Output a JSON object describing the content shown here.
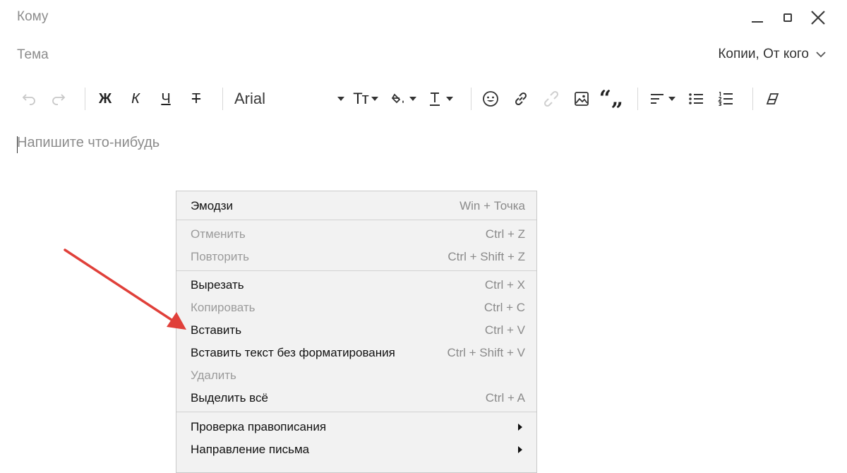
{
  "header": {
    "to_label": "Кому",
    "subject_label": "Тема",
    "copies_toggle": "Копии, От кого"
  },
  "toolbar": {
    "bold": "Ж",
    "italic": "К",
    "underline": "Ч",
    "strike": "Т",
    "font_family": "Arial",
    "font_size_label": "Тт",
    "icons": [
      "undo-icon",
      "redo-icon",
      "font-size-icon",
      "fill-color-icon",
      "text-color-icon",
      "emoji-icon",
      "link-icon",
      "unlink-icon",
      "image-icon",
      "quote-icon",
      "align-icon",
      "bullet-list-icon",
      "numbered-list-icon",
      "clear-format-icon"
    ]
  },
  "editor": {
    "placeholder": "Напишите что-нибудь"
  },
  "context_menu": {
    "items": [
      {
        "label": "Эмодзи",
        "shortcut": "Win + Точка",
        "enabled": true
      },
      {
        "label": "Отменить",
        "shortcut": "Ctrl + Z",
        "enabled": false
      },
      {
        "label": "Повторить",
        "shortcut": "Ctrl + Shift + Z",
        "enabled": false
      },
      {
        "label": "Вырезать",
        "shortcut": "Ctrl + X",
        "enabled": true
      },
      {
        "label": "Копировать",
        "shortcut": "Ctrl + C",
        "enabled": false
      },
      {
        "label": "Вставить",
        "shortcut": "Ctrl + V",
        "enabled": true
      },
      {
        "label": "Вставить текст без форматирования",
        "shortcut": "Ctrl + Shift + V",
        "enabled": true
      },
      {
        "label": "Удалить",
        "shortcut": "",
        "enabled": false
      },
      {
        "label": "Выделить всё",
        "shortcut": "Ctrl + A",
        "enabled": true
      },
      {
        "label": "Проверка правописания",
        "shortcut": "",
        "enabled": true,
        "submenu": true
      },
      {
        "label": "Направление письма",
        "shortcut": "",
        "enabled": true,
        "submenu": true
      }
    ]
  },
  "colors": {
    "annotation_arrow": "#e0403a",
    "disabled_text": "#9b9b9b",
    "menu_background": "#f2f2f2"
  }
}
